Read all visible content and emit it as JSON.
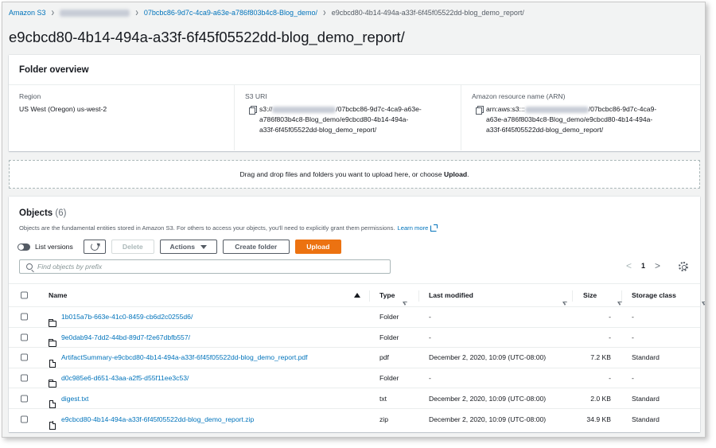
{
  "breadcrumb": {
    "root": "Amazon S3",
    "bucket_hidden": true,
    "folder": "07bcbc86-9d7c-4ca9-a63e-a786f803b4c8-Blog_demo/",
    "current": "e9cbcd80-4b14-494a-a33f-6f45f05522dd-blog_demo_report/"
  },
  "page_title": "e9cbcd80-4b14-494a-a33f-6f45f05522dd-blog_demo_report/",
  "overview": {
    "heading": "Folder overview",
    "region_label": "Region",
    "region_value": "US West (Oregon) us-west-2",
    "s3uri_label": "S3 URI",
    "s3uri_prefix": "s3://",
    "s3uri_line1_rest": "/07bcbc86-9d7c-4ca9-a63e-",
    "s3uri_line2": "a786f803b4c8-Blog_demo/e9cbcd80-4b14-494a-",
    "s3uri_line3": "a33f-6f45f05522dd-blog_demo_report/",
    "arn_label": "Amazon resource name (ARN)",
    "arn_prefix": "arn:aws:s3:::",
    "arn_line1_rest": "/07bcbc86-9d7c-4ca9-",
    "arn_line2": "a63e-a786f803b4c8-Blog_demo/e9cbcd80-4b14-494a-",
    "arn_line3": "a33f-6f45f05522dd-blog_demo_report/"
  },
  "dropzone": {
    "text": "Drag and drop files and folders you want to upload here, or choose ",
    "bold": "Upload",
    "end": "."
  },
  "objects": {
    "title": "Objects",
    "count": "(6)",
    "description": "Objects are the fundamental entities stored in Amazon S3. For others to access your objects, you'll need to explicitly grant them permissions.",
    "learn_more": "Learn more",
    "toolbar": {
      "list_versions": "List versions",
      "delete": "Delete",
      "actions": "Actions",
      "create_folder": "Create folder",
      "upload": "Upload"
    },
    "search_placeholder": "Find objects by prefix",
    "page": "1",
    "columns": {
      "name": "Name",
      "type": "Type",
      "last_modified": "Last modified",
      "size": "Size",
      "storage_class": "Storage class"
    },
    "rows": [
      {
        "name": "1b015a7b-663e-41c0-8459-cb6d2c0255d6/",
        "icon": "folder-icon",
        "type": "Folder",
        "last_modified": "-",
        "size": "-",
        "storage_class": "-"
      },
      {
        "name": "9e0dab94-7dd2-44bd-89d7-f2e67dbfb557/",
        "icon": "folder-icon",
        "type": "Folder",
        "last_modified": "-",
        "size": "-",
        "storage_class": "-"
      },
      {
        "name": "ArtifactSummary-e9cbcd80-4b14-494a-a33f-6f45f05522dd-blog_demo_report.pdf",
        "icon": "file-icon",
        "type": "pdf",
        "last_modified": "December 2, 2020, 10:09 (UTC-08:00)",
        "size": "7.2 KB",
        "storage_class": "Standard"
      },
      {
        "name": "d0c985e6-d651-43aa-a2f5-d55f11ee3c53/",
        "icon": "folder-icon",
        "type": "Folder",
        "last_modified": "-",
        "size": "-",
        "storage_class": "-"
      },
      {
        "name": "digest.txt",
        "icon": "file-icon",
        "type": "txt",
        "last_modified": "December 2, 2020, 10:09 (UTC-08:00)",
        "size": "2.0 KB",
        "storage_class": "Standard"
      },
      {
        "name": "e9cbcd80-4b14-494a-a33f-6f45f05522dd-blog_demo_report.zip",
        "icon": "file-icon",
        "type": "zip",
        "last_modified": "December 2, 2020, 10:09 (UTC-08:00)",
        "size": "34.9 KB",
        "storage_class": "Standard"
      }
    ]
  },
  "colors": {
    "link": "#0073bb",
    "primary_button": "#ec7211",
    "background": "#f2f3f3"
  }
}
